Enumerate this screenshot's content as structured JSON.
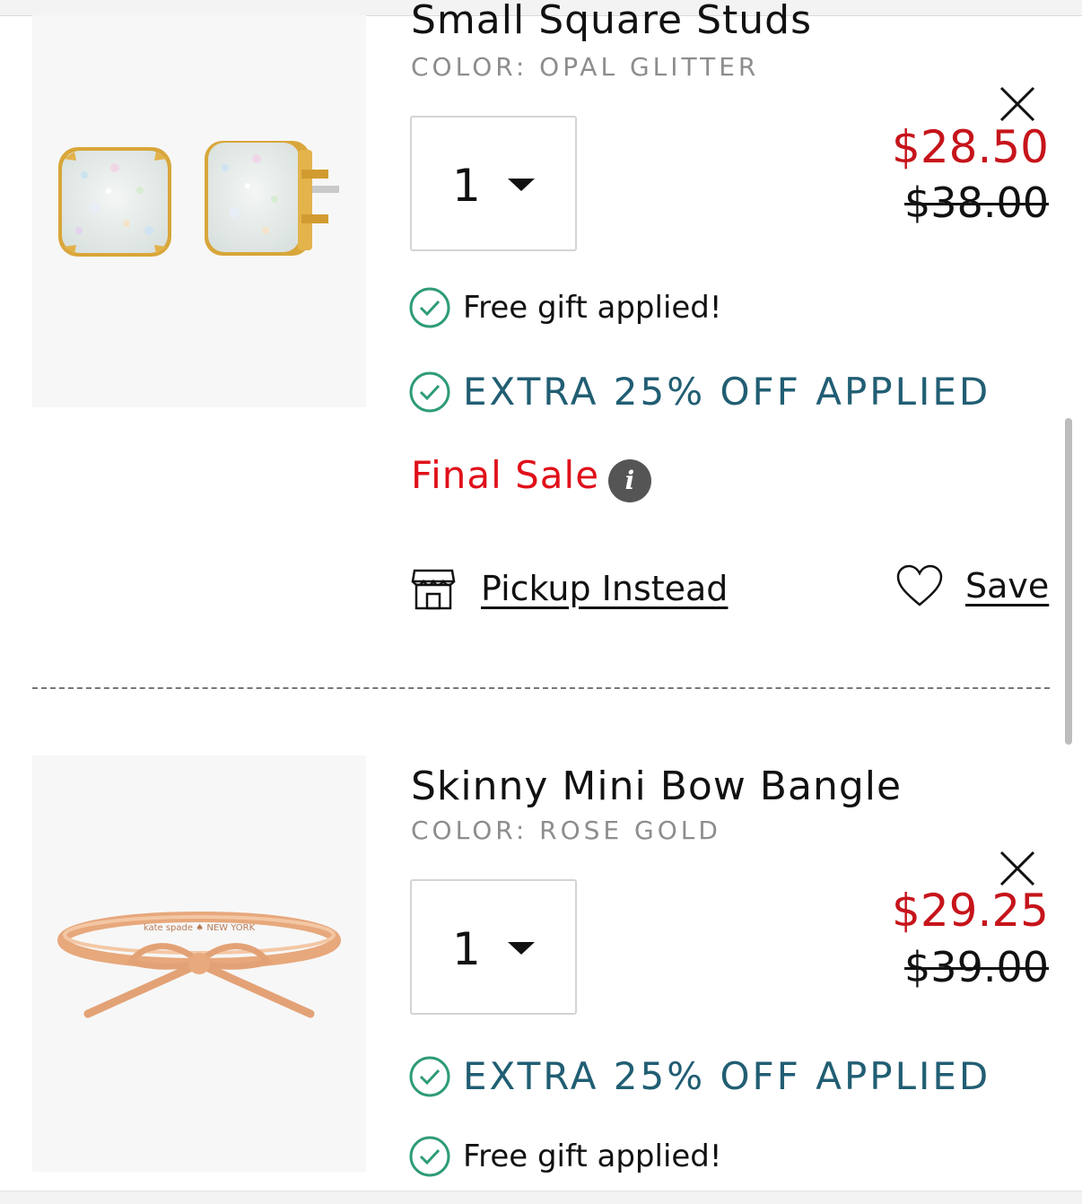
{
  "items": [
    {
      "title": "Small Square Studs",
      "color_line": "COLOR: OPAL GLITTER",
      "quantity": "1",
      "sale_price": "$28.50",
      "original_price": "$38.00",
      "free_gift_text": "Free gift applied!",
      "extra_off_text": "EXTRA 25% OFF APPLIED",
      "final_sale_text": "Final Sale",
      "info_icon": "i",
      "pickup_label": "Pickup Instead",
      "save_label": "Save"
    },
    {
      "title": "Skinny Mini Bow Bangle",
      "color_line": "COLOR: ROSE GOLD",
      "quantity": "1",
      "sale_price": "$29.25",
      "original_price": "$39.00",
      "extra_off_text": "EXTRA 25% OFF APPLIED",
      "free_gift_text": "Free gift applied!",
      "engraving": "kate spade ♠ NEW YORK"
    }
  ],
  "colors": {
    "sale_red": "#c6141b",
    "final_sale_red": "#e0101a",
    "promo_teal": "#215e73",
    "check_green": "#2e9b79",
    "muted_gray": "#8d8d8d"
  },
  "icons": [
    "close-icon",
    "check-circle-icon",
    "info-icon",
    "store-icon",
    "heart-icon",
    "chevron-down-icon"
  ]
}
